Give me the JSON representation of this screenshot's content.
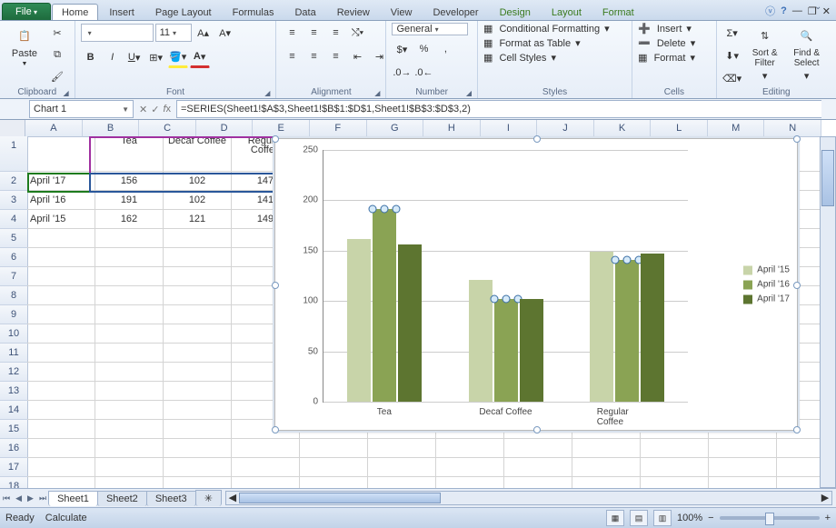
{
  "tabs": {
    "file": "File",
    "home": "Home",
    "insert": "Insert",
    "pagelayout": "Page Layout",
    "formulas": "Formulas",
    "data": "Data",
    "review": "Review",
    "view": "View",
    "developer": "Developer",
    "design": "Design",
    "layout": "Layout",
    "format": "Format"
  },
  "ribbon": {
    "clipboard": {
      "label": "Clipboard",
      "paste": "Paste"
    },
    "font": {
      "label": "Font",
      "size": "11"
    },
    "alignment": {
      "label": "Alignment"
    },
    "number": {
      "label": "Number",
      "format": "General"
    },
    "styles": {
      "label": "Styles",
      "cond": "Conditional Formatting",
      "table": "Format as Table",
      "cell": "Cell Styles"
    },
    "cells": {
      "label": "Cells",
      "insert": "Insert",
      "delete": "Delete",
      "format": "Format"
    },
    "editing": {
      "label": "Editing",
      "sort": "Sort & Filter",
      "find": "Find & Select"
    }
  },
  "namebox": "Chart 1",
  "formula": "=SERIES(Sheet1!$A$3,Sheet1!$B$1:$D$1,Sheet1!$B$3:$D$3,2)",
  "columns": [
    "A",
    "B",
    "C",
    "D",
    "E",
    "F",
    "G",
    "H",
    "I",
    "J",
    "K",
    "L",
    "M",
    "N"
  ],
  "rows": [
    "1",
    "2",
    "3",
    "4",
    "5",
    "6",
    "7",
    "8",
    "9",
    "10",
    "11",
    "12",
    "13",
    "14",
    "15",
    "16",
    "17",
    "18"
  ],
  "data": {
    "headers": {
      "B1": "Tea",
      "C1": "Decaf Coffee",
      "D1": "Regular Coffee"
    },
    "A2": "April '17",
    "B2": "156",
    "C2": "102",
    "D2": "147",
    "A3": "April '16",
    "B3": "191",
    "C3": "102",
    "D3": "141",
    "A4": "April '15",
    "B4": "162",
    "C4": "121",
    "D4": "149"
  },
  "chart_data": {
    "type": "bar",
    "categories": [
      "Tea",
      "Decaf Coffee",
      "Regular Coffee"
    ],
    "series": [
      {
        "name": "April '15",
        "values": [
          162,
          121,
          149
        ],
        "color": "#c8d4a9"
      },
      {
        "name": "April '16",
        "values": [
          191,
          102,
          141
        ],
        "color": "#8aa354"
      },
      {
        "name": "April '17",
        "values": [
          156,
          102,
          147
        ],
        "color": "#5d7530"
      }
    ],
    "ylim": [
      0,
      250
    ],
    "yticks": [
      0,
      50,
      100,
      150,
      200,
      250
    ],
    "selected_series": "April '16",
    "xlabel": "",
    "ylabel": "",
    "title": ""
  },
  "sheets": {
    "s1": "Sheet1",
    "s2": "Sheet2",
    "s3": "Sheet3"
  },
  "status": {
    "ready": "Ready",
    "calculate": "Calculate",
    "zoom": "100%"
  }
}
